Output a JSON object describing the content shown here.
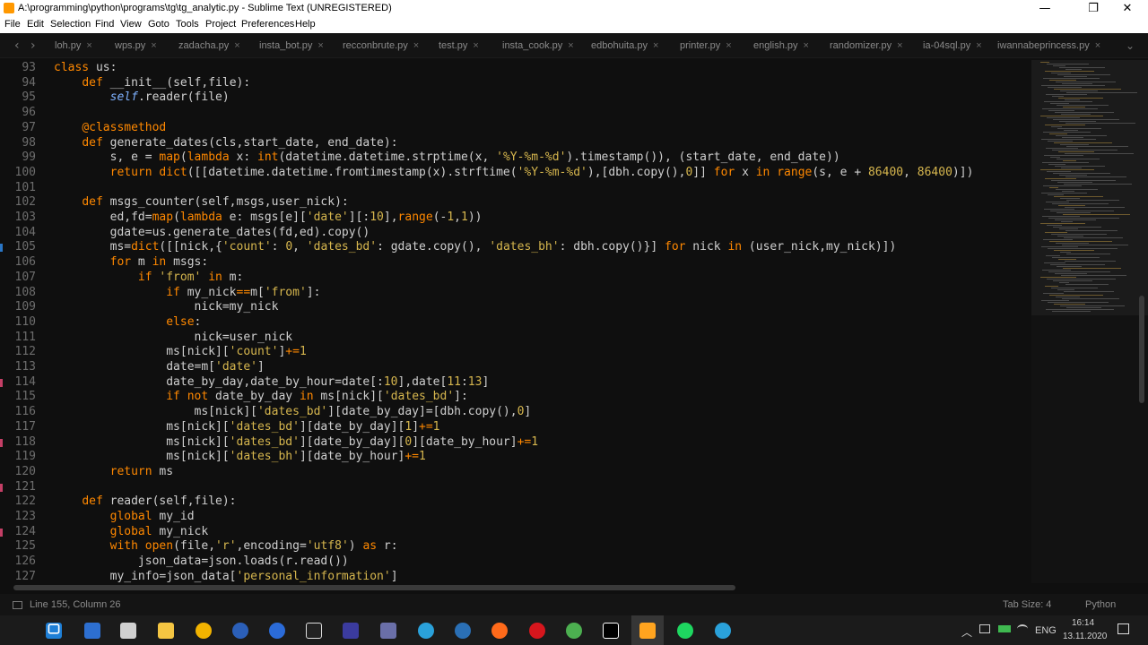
{
  "window": {
    "title": "A:\\programming\\python\\programs\\tg\\tg_analytic.py - Sublime Text (UNREGISTERED)",
    "minimize": "—",
    "maximize": "❐",
    "close": "✕"
  },
  "menu": [
    "File",
    "Edit",
    "Selection",
    "Find",
    "View",
    "Goto",
    "Tools",
    "Project",
    "Preferences",
    "Help"
  ],
  "tabs": [
    {
      "label": "loh.py",
      "close": "×"
    },
    {
      "label": "wps.py",
      "close": "×"
    },
    {
      "label": "zadacha.py",
      "close": "×"
    },
    {
      "label": "insta_bot.py",
      "close": "×"
    },
    {
      "label": "recconbrute.py",
      "close": "×"
    },
    {
      "label": "test.py",
      "close": "×"
    },
    {
      "label": "insta_cook.py",
      "close": "×"
    },
    {
      "label": "edbohuita.py",
      "close": "×"
    },
    {
      "label": "printer.py",
      "close": "×"
    },
    {
      "label": "english.py",
      "close": "×"
    },
    {
      "label": "randomizer.py",
      "close": "×"
    },
    {
      "label": "ia-04sql.py",
      "close": "×"
    },
    {
      "label": "iwannabeprincess.py",
      "close": "×"
    }
  ],
  "tab_nav": {
    "prev": "‹",
    "next": "›",
    "dropdown": "⌄"
  },
  "editor": {
    "lines": [
      {
        "no": "93",
        "tokens": [
          [
            "k",
            "class"
          ],
          [
            "d",
            " us:"
          ]
        ]
      },
      {
        "no": "94",
        "tokens": [
          [
            "d",
            "    "
          ],
          [
            "k",
            "def"
          ],
          [
            "d",
            " __init__("
          ],
          [
            "d",
            "self,file):"
          ]
        ]
      },
      {
        "no": "95",
        "tokens": [
          [
            "d",
            "        "
          ],
          [
            "sf",
            "self"
          ],
          [
            "d",
            ".reader(file)"
          ]
        ]
      },
      {
        "no": "96",
        "tokens": []
      },
      {
        "no": "97",
        "tokens": [
          [
            "d",
            "    "
          ],
          [
            "k",
            "@classmethod"
          ]
        ]
      },
      {
        "no": "98",
        "tokens": [
          [
            "d",
            "    "
          ],
          [
            "k",
            "def"
          ],
          [
            "d",
            " generate_dates(cls,start_date, end_date):"
          ]
        ]
      },
      {
        "no": "99",
        "tokens": [
          [
            "d",
            "        s, e = "
          ],
          [
            "k",
            "map"
          ],
          [
            "d",
            "("
          ],
          [
            "k",
            "lambda"
          ],
          [
            "d",
            " x: "
          ],
          [
            "k",
            "int"
          ],
          [
            "d",
            "(datetime.datetime.strptime(x, "
          ],
          [
            "s",
            "'%Y-%m-%d'"
          ],
          [
            "d",
            ").timestamp()), (start_date, end_date))"
          ]
        ]
      },
      {
        "no": "100",
        "tokens": [
          [
            "d",
            "        "
          ],
          [
            "k",
            "return"
          ],
          [
            "d",
            " "
          ],
          [
            "k",
            "dict"
          ],
          [
            "d",
            "([[datetime.datetime.fromtimestamp(x).strftime("
          ],
          [
            "s",
            "'%Y-%m-%d'"
          ],
          [
            "d",
            "),[dbh.copy(),"
          ],
          [
            "n",
            "0"
          ],
          [
            "d",
            "]] "
          ],
          [
            "k",
            "for"
          ],
          [
            "d",
            " x "
          ],
          [
            "k",
            "in"
          ],
          [
            "d",
            " "
          ],
          [
            "k",
            "range"
          ],
          [
            "d",
            "(s, e + "
          ],
          [
            "n",
            "86400"
          ],
          [
            "d",
            ", "
          ],
          [
            "n",
            "86400"
          ],
          [
            "d",
            ")])"
          ]
        ]
      },
      {
        "no": "101",
        "tokens": []
      },
      {
        "no": "102",
        "tokens": [
          [
            "d",
            "    "
          ],
          [
            "k",
            "def"
          ],
          [
            "d",
            " msgs_counter(self,msgs,user_nick):"
          ]
        ]
      },
      {
        "no": "103",
        "tokens": [
          [
            "d",
            "        ed,fd="
          ],
          [
            "k",
            "map"
          ],
          [
            "d",
            "("
          ],
          [
            "k",
            "lambda"
          ],
          [
            "d",
            " e: msgs[e]["
          ],
          [
            "s",
            "'date'"
          ],
          [
            "d",
            "][:"
          ],
          [
            "n",
            "10"
          ],
          [
            "d",
            "],"
          ],
          [
            "k",
            "range"
          ],
          [
            "d",
            "(-"
          ],
          [
            "n",
            "1"
          ],
          [
            "d",
            ","
          ],
          [
            "n",
            "1"
          ],
          [
            "d",
            "))"
          ]
        ]
      },
      {
        "no": "104",
        "tokens": [
          [
            "d",
            "        gdate=us.generate_dates(fd,ed).copy()"
          ]
        ]
      },
      {
        "no": "105",
        "tokens": [
          [
            "d",
            "        ms="
          ],
          [
            "k",
            "dict"
          ],
          [
            "d",
            "([[nick,{"
          ],
          [
            "s",
            "'count'"
          ],
          [
            "d",
            ": "
          ],
          [
            "n",
            "0"
          ],
          [
            "d",
            ", "
          ],
          [
            "s",
            "'dates_bd'"
          ],
          [
            "d",
            ": gdate.copy(), "
          ],
          [
            "s",
            "'dates_bh'"
          ],
          [
            "d",
            ": dbh.copy()}] "
          ],
          [
            "k",
            "for"
          ],
          [
            "d",
            " nick "
          ],
          [
            "k",
            "in"
          ],
          [
            "d",
            " (user_nick,my_nick)])"
          ]
        ]
      },
      {
        "no": "106",
        "tokens": [
          [
            "d",
            "        "
          ],
          [
            "k",
            "for"
          ],
          [
            "d",
            " m "
          ],
          [
            "k",
            "in"
          ],
          [
            "d",
            " msgs:"
          ]
        ]
      },
      {
        "no": "107",
        "tokens": [
          [
            "d",
            "            "
          ],
          [
            "k",
            "if"
          ],
          [
            "d",
            " "
          ],
          [
            "s",
            "'from'"
          ],
          [
            "d",
            " "
          ],
          [
            "k",
            "in"
          ],
          [
            "d",
            " m:"
          ]
        ]
      },
      {
        "no": "108",
        "tokens": [
          [
            "d",
            "                "
          ],
          [
            "k",
            "if"
          ],
          [
            "d",
            " my_nick"
          ],
          [
            "k",
            "=="
          ],
          [
            "d",
            "m["
          ],
          [
            "s",
            "'from'"
          ],
          [
            "d",
            "]:"
          ]
        ]
      },
      {
        "no": "109",
        "tokens": [
          [
            "d",
            "                    nick=my_nick"
          ]
        ]
      },
      {
        "no": "110",
        "tokens": [
          [
            "d",
            "                "
          ],
          [
            "k",
            "else"
          ],
          [
            "d",
            ":"
          ]
        ]
      },
      {
        "no": "111",
        "tokens": [
          [
            "d",
            "                    nick=user_nick"
          ]
        ]
      },
      {
        "no": "112",
        "tokens": [
          [
            "d",
            "                ms[nick]["
          ],
          [
            "s",
            "'count'"
          ],
          [
            "d",
            "]"
          ],
          [
            "k",
            "+="
          ],
          [
            "n",
            "1"
          ]
        ]
      },
      {
        "no": "113",
        "tokens": [
          [
            "d",
            "                date=m["
          ],
          [
            "s",
            "'date'"
          ],
          [
            "d",
            "]"
          ]
        ]
      },
      {
        "no": "114",
        "tokens": [
          [
            "d",
            "                date_by_day,date_by_hour=date[:"
          ],
          [
            "n",
            "10"
          ],
          [
            "d",
            "],date["
          ],
          [
            "n",
            "11"
          ],
          [
            "d",
            ":"
          ],
          [
            "n",
            "13"
          ],
          [
            "d",
            "]"
          ]
        ]
      },
      {
        "no": "115",
        "tokens": [
          [
            "d",
            "                "
          ],
          [
            "k",
            "if"
          ],
          [
            "d",
            " "
          ],
          [
            "k",
            "not"
          ],
          [
            "d",
            " date_by_day "
          ],
          [
            "k",
            "in"
          ],
          [
            "d",
            " ms[nick]["
          ],
          [
            "s",
            "'dates_bd'"
          ],
          [
            "d",
            "]:"
          ]
        ]
      },
      {
        "no": "116",
        "tokens": [
          [
            "d",
            "                    ms[nick]["
          ],
          [
            "s",
            "'dates_bd'"
          ],
          [
            "d",
            "][date_by_day]=[dbh.copy(),"
          ],
          [
            "n",
            "0"
          ],
          [
            "d",
            "]"
          ]
        ]
      },
      {
        "no": "117",
        "tokens": [
          [
            "d",
            "                ms[nick]["
          ],
          [
            "s",
            "'dates_bd'"
          ],
          [
            "d",
            "][date_by_day]["
          ],
          [
            "n",
            "1"
          ],
          [
            "d",
            "]"
          ],
          [
            "k",
            "+="
          ],
          [
            "n",
            "1"
          ]
        ]
      },
      {
        "no": "118",
        "tokens": [
          [
            "d",
            "                ms[nick]["
          ],
          [
            "s",
            "'dates_bd'"
          ],
          [
            "d",
            "][date_by_day]["
          ],
          [
            "n",
            "0"
          ],
          [
            "d",
            "][date_by_hour]"
          ],
          [
            "k",
            "+="
          ],
          [
            "n",
            "1"
          ]
        ]
      },
      {
        "no": "119",
        "tokens": [
          [
            "d",
            "                ms[nick]["
          ],
          [
            "s",
            "'dates_bh'"
          ],
          [
            "d",
            "][date_by_hour]"
          ],
          [
            "k",
            "+="
          ],
          [
            "n",
            "1"
          ]
        ]
      },
      {
        "no": "120",
        "tokens": [
          [
            "d",
            "        "
          ],
          [
            "k",
            "return"
          ],
          [
            "d",
            " ms"
          ]
        ]
      },
      {
        "no": "121",
        "tokens": []
      },
      {
        "no": "122",
        "tokens": [
          [
            "d",
            "    "
          ],
          [
            "k",
            "def"
          ],
          [
            "d",
            " reader(self,file):"
          ]
        ]
      },
      {
        "no": "123",
        "tokens": [
          [
            "d",
            "        "
          ],
          [
            "k",
            "global"
          ],
          [
            "d",
            " my_id"
          ]
        ]
      },
      {
        "no": "124",
        "tokens": [
          [
            "d",
            "        "
          ],
          [
            "k",
            "global"
          ],
          [
            "d",
            " my_nick"
          ]
        ]
      },
      {
        "no": "125",
        "tokens": [
          [
            "d",
            "        "
          ],
          [
            "k",
            "with"
          ],
          [
            "d",
            " "
          ],
          [
            "k",
            "open"
          ],
          [
            "d",
            "(file,"
          ],
          [
            "s",
            "'r'"
          ],
          [
            "d",
            ",encoding="
          ],
          [
            "s",
            "'utf8'"
          ],
          [
            "d",
            ") "
          ],
          [
            "k",
            "as"
          ],
          [
            "d",
            " r:"
          ]
        ]
      },
      {
        "no": "126",
        "tokens": [
          [
            "d",
            "            json_data=json.loads(r.read())"
          ]
        ]
      },
      {
        "no": "127",
        "tokens": [
          [
            "d",
            "        my_info=json_data["
          ],
          [
            "s",
            "'personal_information'"
          ],
          [
            "d",
            "]"
          ]
        ]
      }
    ]
  },
  "status": {
    "position": "Line 155, Column 26",
    "tab_size": "Tab Size: 4",
    "syntax": "Python"
  },
  "taskbar": {
    "lang": "ENG",
    "time": "16:14",
    "date": "13.11.2020"
  }
}
